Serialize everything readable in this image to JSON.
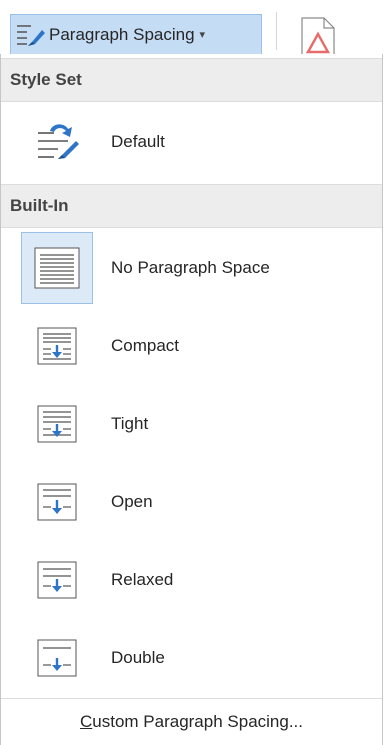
{
  "toolbar": {
    "paragraph_spacing_label": "Paragraph Spacing",
    "dropdown_arrow": "▾",
    "accent_color": "#c5dcf5"
  },
  "menu": {
    "style_set_header": "Style Set",
    "default_label": "Default",
    "built_in_header": "Built-In",
    "items": [
      {
        "label": "No Paragraph Space",
        "icon": "no-paragraph-space-icon"
      },
      {
        "label": "Compact",
        "icon": "compact-spacing-icon"
      },
      {
        "label": "Tight",
        "icon": "tight-spacing-icon"
      },
      {
        "label": "Open",
        "icon": "open-spacing-icon"
      },
      {
        "label": "Relaxed",
        "icon": "relaxed-spacing-icon"
      },
      {
        "label": "Double",
        "icon": "double-spacing-icon"
      }
    ],
    "custom_accel": "C",
    "custom_rest": "ustom Paragraph Spacing..."
  }
}
